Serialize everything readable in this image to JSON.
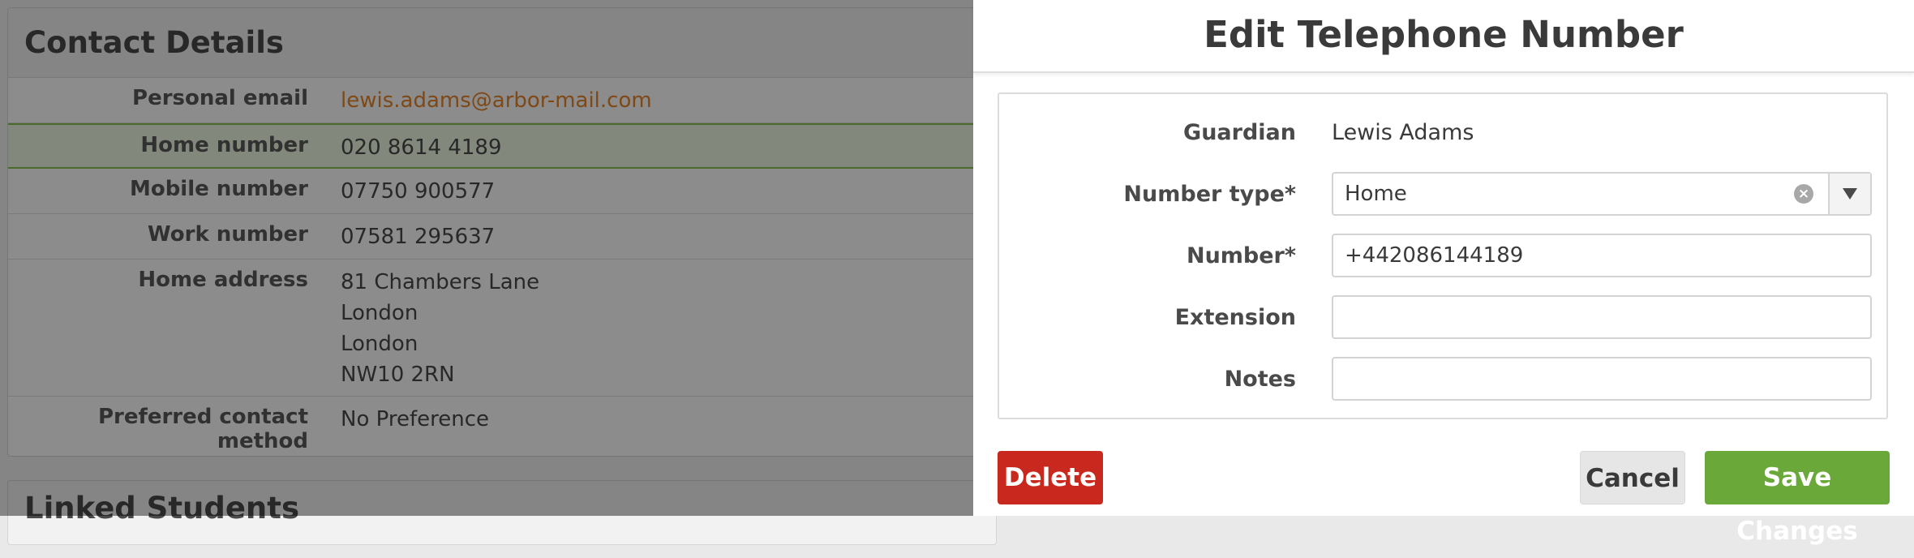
{
  "background": {
    "section_title": "Contact Details",
    "rows": [
      {
        "label": "Personal email",
        "values": [
          "lewis.adams@arbor-mail.com"
        ]
      },
      {
        "label": "Home number",
        "values": [
          "020 8614 4189"
        ]
      },
      {
        "label": "Mobile number",
        "values": [
          "07750 900577"
        ]
      },
      {
        "label": "Work number",
        "values": [
          "07581 295637"
        ]
      },
      {
        "label": "Home address",
        "values": [
          "81 Chambers Lane",
          "London",
          "London",
          "NW10 2RN"
        ]
      },
      {
        "label": "Preferred contact method",
        "values": [
          "No Preference"
        ]
      }
    ],
    "next_section_title": "Linked Students"
  },
  "modal": {
    "title": "Edit Telephone Number",
    "fields": {
      "guardian": {
        "label": "Guardian",
        "value": "Lewis Adams"
      },
      "number_type": {
        "label": "Number type*",
        "value": "Home"
      },
      "number": {
        "label": "Number*",
        "value": "+442086144189"
      },
      "extension": {
        "label": "Extension",
        "value": ""
      },
      "notes": {
        "label": "Notes",
        "value": ""
      }
    },
    "buttons": {
      "delete": "Delete",
      "cancel": "Cancel",
      "save": "Save Changes"
    }
  },
  "colors": {
    "link": "#e5852b",
    "highlight_border": "#8cc152",
    "delete": "#c8281e",
    "save": "#6aa83a"
  },
  "icons": {
    "clear": "clear-circle-icon",
    "dropdown": "triangle-down-icon"
  }
}
